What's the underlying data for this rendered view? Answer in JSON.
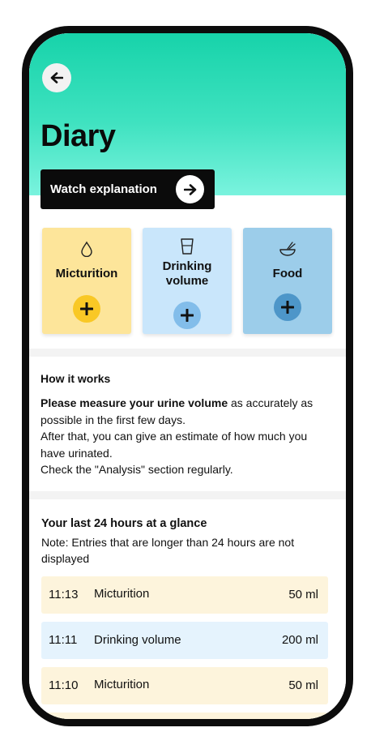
{
  "header": {
    "title": "Diary",
    "watch_label": "Watch explanation"
  },
  "cards": [
    {
      "label": "Micturition"
    },
    {
      "label": "Drinking volume"
    },
    {
      "label": "Food"
    }
  ],
  "how_it_works": {
    "title": "How it works",
    "bold_text": "Please measure your urine volume",
    "text_after_bold": " as accurately as possible in the first few days.",
    "line2": "After that, you can give an estimate of how much you have urinated.",
    "line3": "Check the \"Analysis\" section regularly."
  },
  "glance": {
    "title": "Your last 24 hours at a glance",
    "note": "Note: Entries that are longer than 24 hours are not displayed"
  },
  "entries": [
    {
      "time": "11:13",
      "type": "Micturition",
      "volume": "50 ml"
    },
    {
      "time": "11:11",
      "type": "Drinking volume",
      "volume": "200 ml"
    },
    {
      "time": "11:10",
      "type": "Micturition",
      "volume": "50 ml"
    }
  ],
  "colors": {
    "header_top": "#17d3aa",
    "header_bottom": "#7af3de",
    "micturition_card": "#fde59a",
    "drinking_card": "#c9e6fb",
    "food_card": "#9ccdea",
    "micturition_add": "#f9c825",
    "drinking_add": "#82bdea",
    "food_add": "#4d96c9"
  },
  "icons": {
    "back": "arrow-left-icon",
    "watch": "arrow-right-icon",
    "micturition": "droplet-icon",
    "drinking": "glass-icon",
    "food": "bowl-icon",
    "add": "plus-icon"
  }
}
